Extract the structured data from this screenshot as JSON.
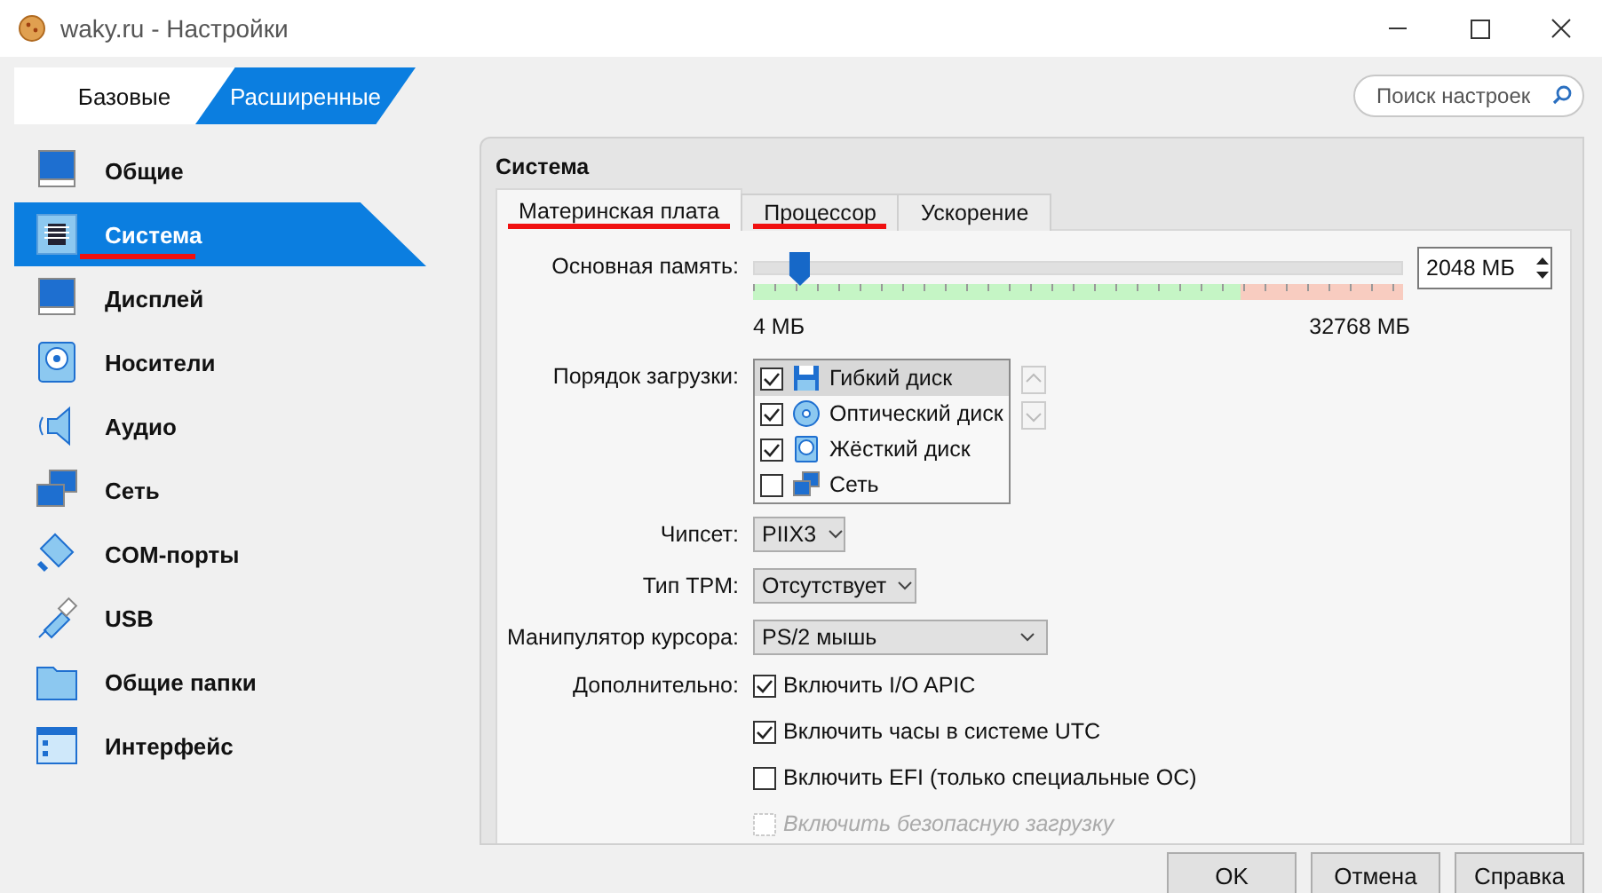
{
  "window": {
    "title": "waky.ru - Настройки"
  },
  "mode_tabs": [
    {
      "label": "Базовые",
      "selected": false
    },
    {
      "label": "Расширенные",
      "selected": true
    }
  ],
  "search": {
    "placeholder": "Поиск настроек"
  },
  "sidebar": {
    "items": [
      {
        "label": "Общие",
        "kind": "general",
        "selected": false,
        "underlined": false
      },
      {
        "label": "Система",
        "kind": "system",
        "selected": true,
        "underlined": true
      },
      {
        "label": "Дисплей",
        "kind": "display",
        "selected": false,
        "underlined": false
      },
      {
        "label": "Носители",
        "kind": "storage",
        "selected": false,
        "underlined": false
      },
      {
        "label": "Аудио",
        "kind": "audio",
        "selected": false,
        "underlined": false
      },
      {
        "label": "Сеть",
        "kind": "network",
        "selected": false,
        "underlined": false
      },
      {
        "label": "COM-порты",
        "kind": "serial",
        "selected": false,
        "underlined": false
      },
      {
        "label": "USB",
        "kind": "usb",
        "selected": false,
        "underlined": false
      },
      {
        "label": "Общие папки",
        "kind": "folders",
        "selected": false,
        "underlined": false
      },
      {
        "label": "Интерфейс",
        "kind": "interface",
        "selected": false,
        "underlined": false
      }
    ]
  },
  "panel": {
    "title": "Система",
    "tabs": [
      {
        "label": "Материнская плата",
        "selected": true,
        "underlined": true
      },
      {
        "label": "Процессор",
        "selected": false,
        "underlined": true
      },
      {
        "label": "Ускорение",
        "selected": false,
        "underlined": false
      }
    ],
    "memory": {
      "label": "Основная память:",
      "level": 0.07,
      "value": "2048 МБ",
      "min_label": "4 МБ",
      "max_label": "32768 МБ"
    },
    "boot_order": {
      "label": "Порядок загрузки:",
      "items": [
        {
          "label": "Гибкий диск",
          "kind": "floppy",
          "checked": true,
          "selected": true
        },
        {
          "label": "Оптический диск",
          "kind": "optical",
          "checked": true,
          "selected": false
        },
        {
          "label": "Жёсткий диск",
          "kind": "hdd",
          "checked": true,
          "selected": false
        },
        {
          "label": "Сеть",
          "kind": "network",
          "checked": false,
          "selected": false
        }
      ]
    },
    "dropdowns": [
      {
        "label": "Чипсет:",
        "value": "PIIX3"
      },
      {
        "label": "Тип TPM:",
        "value": "Отсутствует"
      },
      {
        "label": "Манипулятор курсора:",
        "value": "PS/2 мышь"
      }
    ],
    "extended": {
      "label": "Дополнительно:",
      "options": [
        {
          "label": "Включить I/O APIC",
          "checked": true,
          "disabled": false
        },
        {
          "label": "Включить часы в системе UTC",
          "checked": true,
          "disabled": false
        },
        {
          "label": "Включить EFI (только специальные ОС)",
          "checked": false,
          "disabled": false
        },
        {
          "label": "Включить безопасную загрузку",
          "checked": false,
          "disabled": true
        }
      ]
    }
  },
  "buttons": [
    {
      "label": "OK"
    },
    {
      "label": "Отмена"
    },
    {
      "label": "Справка"
    }
  ]
}
